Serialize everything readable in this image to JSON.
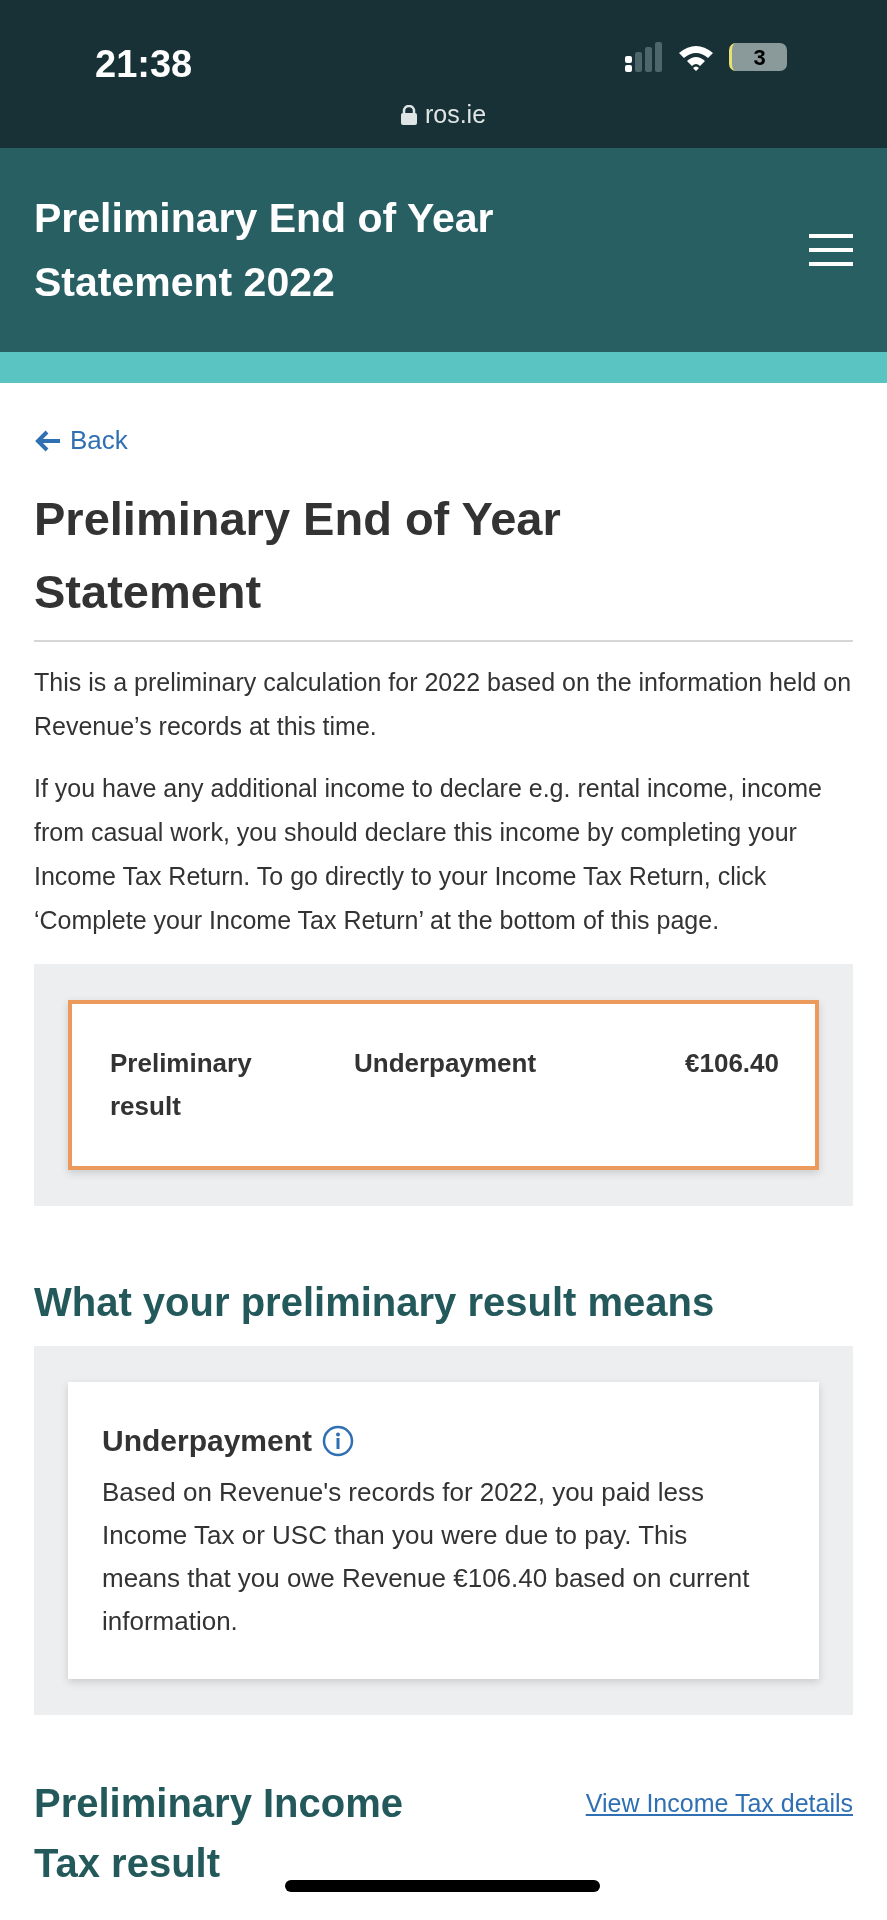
{
  "status_bar": {
    "time": "21:38",
    "url": "ros.ie",
    "battery": "3"
  },
  "header": {
    "title": "Preliminary End of Year Statement 2022"
  },
  "back_link": "Back",
  "page_title": "Preliminary End of Year Statement",
  "intro": [
    "This is a preliminary calculation for 2022 based on the information held on Revenue’s records at this time.",
    "If you have any additional income to declare e.g. rental income, income from casual work, you should declare this income by completing your Income Tax Return. To go directly to your Income Tax Return, click ‘Complete your Income Tax Return’ at the bottom of this page."
  ],
  "result": {
    "label": "Preliminary result",
    "status": "Underpayment",
    "amount": "€106.40"
  },
  "meaning": {
    "heading": "What your preliminary result means",
    "title": "Underpayment",
    "text": "Based on Revenue's records for 2022, you paid less Income Tax or USC than you were due to pay. This means that you owe Revenue €106.40 based on current information."
  },
  "income_tax": {
    "heading": "Preliminary Income Tax result",
    "link": "View Income Tax details"
  }
}
